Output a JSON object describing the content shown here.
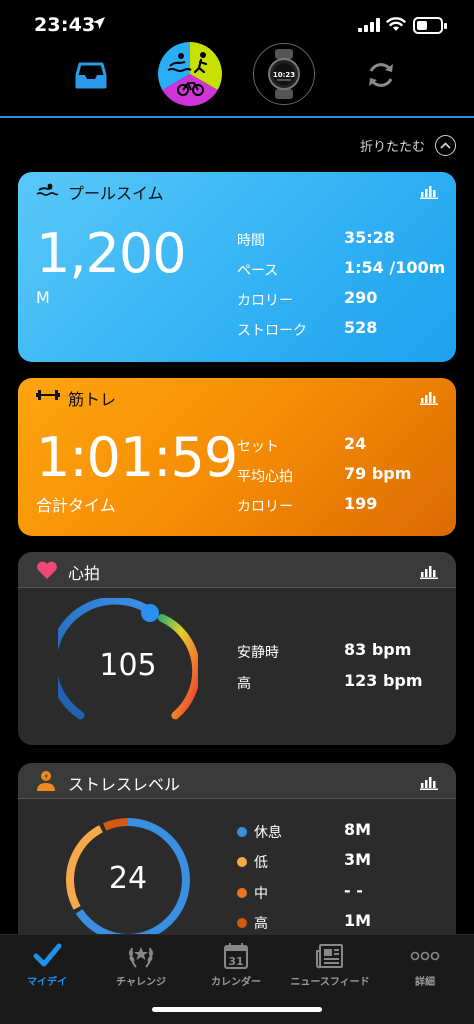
{
  "status_bar": {
    "time": "23:43",
    "battery_level": 0.45
  },
  "collapse_label": "折りたたむ",
  "swim": {
    "title": "プールスイム",
    "distance": "1,200",
    "unit": "M",
    "stats": [
      {
        "label": "時間",
        "value": "35:28"
      },
      {
        "label": "ペース",
        "value": "1:54 /100m"
      },
      {
        "label": "カロリー",
        "value": "290"
      },
      {
        "label": "ストローク",
        "value": "528"
      }
    ]
  },
  "strength": {
    "title": "筋トレ",
    "duration": "1:01:59",
    "duration_label": "合計タイム",
    "stats": [
      {
        "label": "セット",
        "value": "24"
      },
      {
        "label": "平均心拍",
        "value": "79 bpm"
      },
      {
        "label": "カロリー",
        "value": "199"
      }
    ]
  },
  "heart_rate": {
    "title": "心拍",
    "current": "105",
    "stats": [
      {
        "label": "安静時",
        "value": "83 bpm"
      },
      {
        "label": "高",
        "value": "123 bpm"
      }
    ]
  },
  "stress": {
    "title": "ストレスレベル",
    "current": "24",
    "stats": [
      {
        "label": "休息",
        "value": "8M",
        "color": "#3b8fe0"
      },
      {
        "label": "低",
        "value": "3M",
        "color": "#f5a94a"
      },
      {
        "label": "中",
        "value": "- -",
        "color": "#e8761e"
      },
      {
        "label": "高",
        "value": "1M",
        "color": "#d35a10"
      }
    ]
  },
  "tabs": [
    {
      "label": "マイデイ",
      "icon": "check-icon",
      "active": true
    },
    {
      "label": "チャレンジ",
      "icon": "laurel-icon",
      "active": false
    },
    {
      "label": "カレンダー",
      "icon": "calendar-icon",
      "date": "31",
      "active": false
    },
    {
      "label": "ニュースフィード",
      "icon": "newsfeed-icon",
      "active": false
    },
    {
      "label": "詳細",
      "icon": "more-icon",
      "active": false
    }
  ],
  "colors": {
    "accent": "#1e90e8",
    "swim": "#34b3f4",
    "strength": "#f58d05"
  }
}
